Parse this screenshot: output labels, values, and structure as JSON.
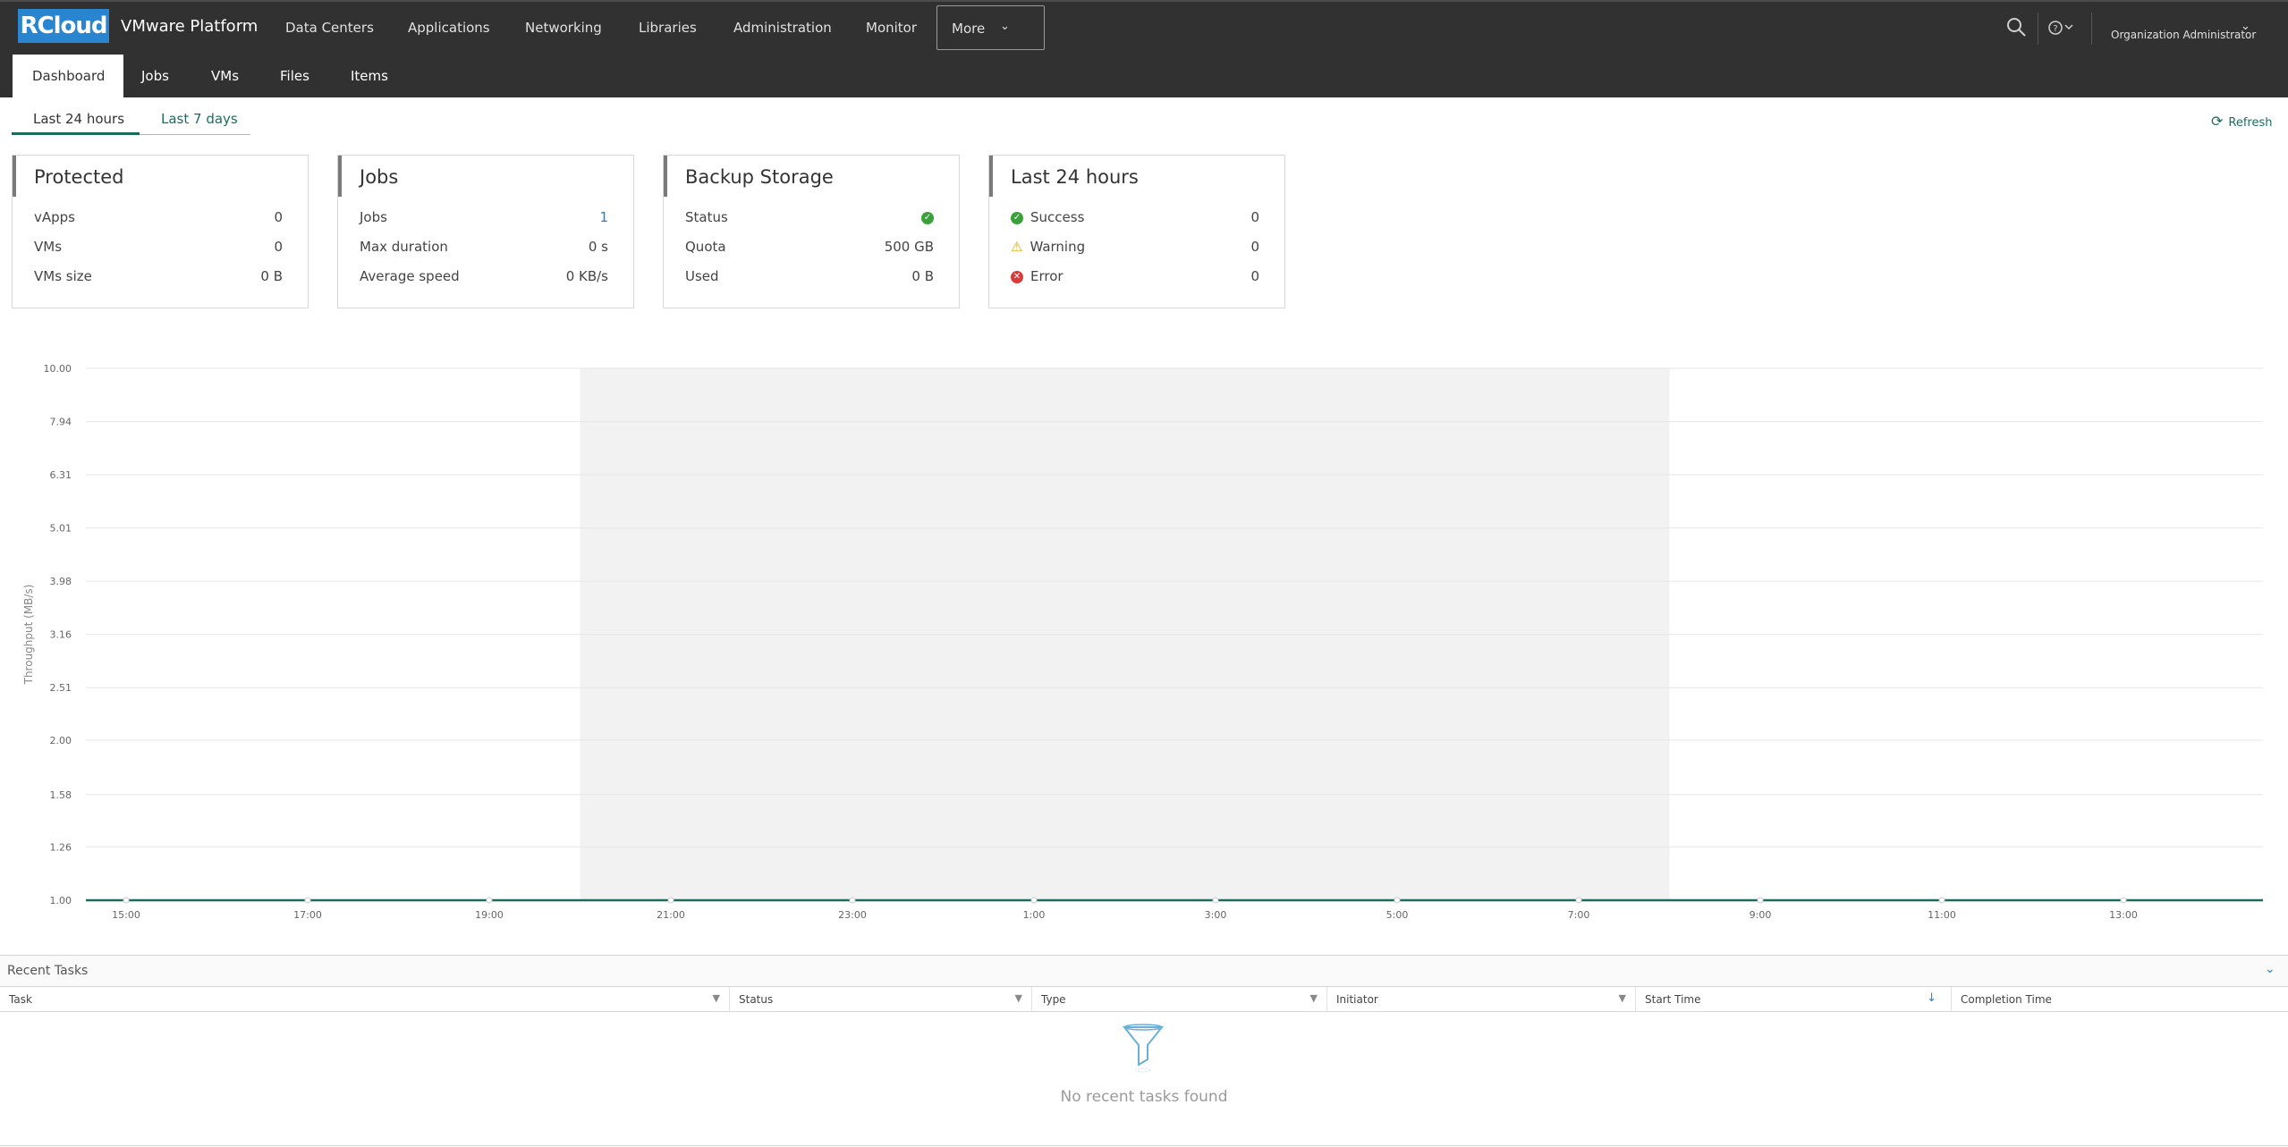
{
  "header": {
    "logo_text": "RCloud",
    "product_name": "VMware Platform",
    "nav": [
      "Data Centers",
      "Applications",
      "Networking",
      "Libraries",
      "Administration",
      "Monitor"
    ],
    "more_label": "More",
    "user_label": "Organization Administrator"
  },
  "subnav": {
    "tabs": [
      "Dashboard",
      "Jobs",
      "VMs",
      "Files",
      "Items"
    ],
    "active": "Dashboard"
  },
  "range": {
    "tabs": [
      "Last 24 hours",
      "Last 7 days"
    ],
    "active": "Last 24 hours",
    "refresh_label": "Refresh"
  },
  "cards": {
    "protected": {
      "title": "Protected",
      "rows": [
        {
          "label": "vApps",
          "value": "0"
        },
        {
          "label": "VMs",
          "value": "0"
        },
        {
          "label": "VMs size",
          "value": "0 B"
        }
      ]
    },
    "jobs": {
      "title": "Jobs",
      "rows": [
        {
          "label": "Jobs",
          "value": "1"
        },
        {
          "label": "Max duration",
          "value": "0 s"
        },
        {
          "label": "Average speed",
          "value": "0 KB/s"
        }
      ]
    },
    "storage": {
      "title": "Backup Storage",
      "rows": [
        {
          "label": "Status",
          "value": ""
        },
        {
          "label": "Quota",
          "value": "500 GB"
        },
        {
          "label": "Used",
          "value": "0 B"
        }
      ]
    },
    "last24": {
      "title": "Last 24 hours",
      "rows": [
        {
          "label": "Success",
          "value": "0"
        },
        {
          "label": "Warning",
          "value": "0"
        },
        {
          "label": "Error",
          "value": "0"
        }
      ]
    }
  },
  "chart_data": {
    "type": "line",
    "title": "",
    "xlabel": "",
    "ylabel": "Throughput (MB/s)",
    "y_ticks": [
      "10.00",
      "7.94",
      "6.31",
      "5.01",
      "3.98",
      "3.16",
      "2.51",
      "2.00",
      "1.58",
      "1.26",
      "1.00"
    ],
    "x_ticks": [
      "15:00",
      "17:00",
      "19:00",
      "21:00",
      "23:00",
      "1:00",
      "3:00",
      "5:00",
      "7:00",
      "9:00",
      "11:00",
      "13:00"
    ],
    "ylim": [
      1,
      10
    ],
    "y_scale": "log",
    "grid": true,
    "series": [
      {
        "values": [
          1,
          1,
          1,
          1,
          1,
          1,
          1,
          1,
          1,
          1,
          1,
          1
        ],
        "color": "#1b6d5a"
      }
    ],
    "shaded_band": {
      "from": "20:00",
      "to": "8:00"
    }
  },
  "tasks": {
    "title": "Recent Tasks",
    "columns": [
      "Task",
      "Status",
      "Type",
      "Initiator",
      "Start Time",
      "Completion Time"
    ],
    "empty_text": "No recent tasks found"
  },
  "colors": {
    "header_bg": "#313131",
    "accent_green": "#1b6d5a",
    "logo_blue": "#2a85d0",
    "link_blue": "#1f7fcc"
  }
}
